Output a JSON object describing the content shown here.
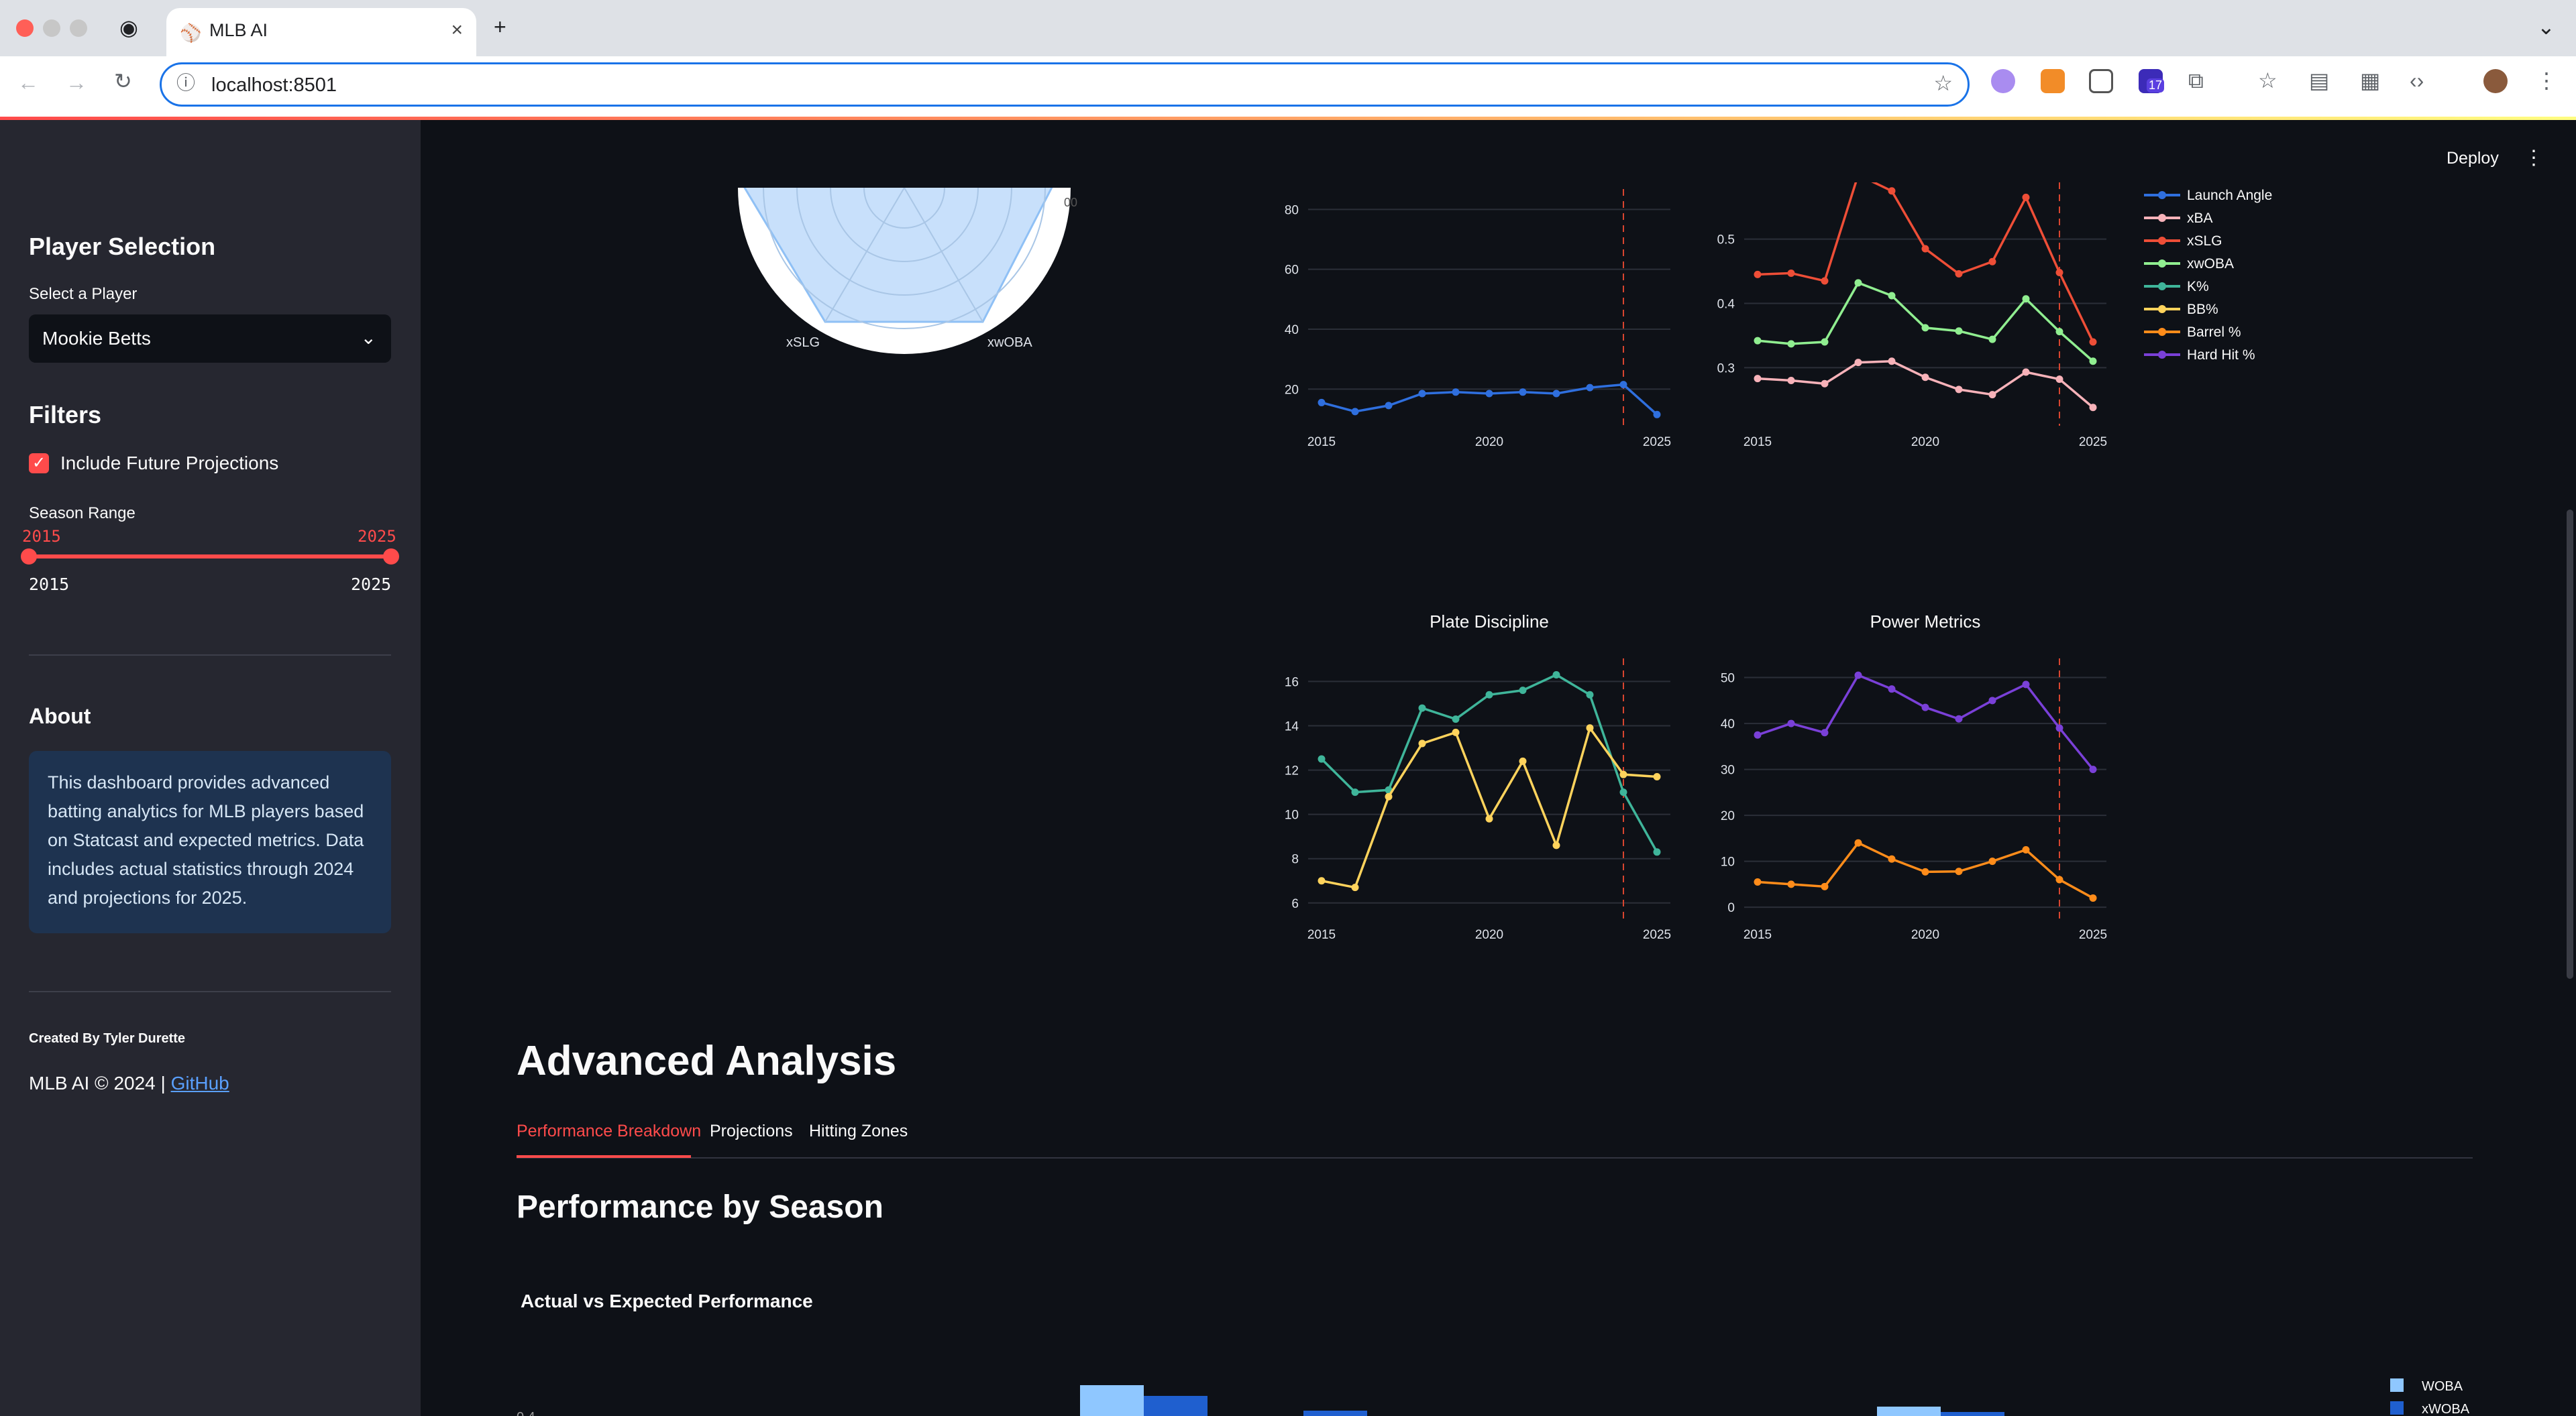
{
  "browser": {
    "tab_title": "MLB AI",
    "url": "localhost:8501",
    "extension_badge": "17"
  },
  "app": {
    "deploy_label": "Deploy",
    "menu_icon": "kebab-icon"
  },
  "sidebar": {
    "player_heading": "Player Selection",
    "select_label": "Select a Player",
    "selected_player": "Mookie Betts",
    "filters_heading": "Filters",
    "checkbox_label": "Include Future Projections",
    "checkbox_checked": true,
    "season_label": "Season Range",
    "slider_low": "2015",
    "slider_high": "2025",
    "range_min": "2015",
    "range_max": "2025",
    "about_heading": "About",
    "about_text": "This dashboard provides advanced batting analytics for MLB players based on Statcast and expected metrics. Data includes actual statistics through 2024 and projections for 2025.",
    "created_by": "Created By Tyler Durette",
    "footer_text": "MLB AI © 2024 | ",
    "footer_link": "GitHub"
  },
  "radar": {
    "labels": [
      "xSLG",
      "xwOBA"
    ],
    "partial_tick": "00"
  },
  "main": {
    "heading": "Advanced Analysis",
    "tabs": [
      "Performance Breakdown",
      "Projections",
      "Hitting Zones"
    ],
    "active_tab": "Performance Breakdown",
    "section_title": "Performance by Season",
    "chart_title": "Actual vs Expected Performance"
  },
  "chart_data": [
    {
      "type": "line",
      "title": "",
      "x": [
        2015,
        2016,
        2017,
        2018,
        2019,
        2020,
        2021,
        2022,
        2023,
        2024,
        2025
      ],
      "x_ticks": [
        2015,
        2020,
        2025
      ],
      "y_ticks": [
        20,
        40,
        60,
        80
      ],
      "projection_marker": 2024,
      "series": [
        {
          "name": "Launch Angle",
          "color": "#2f6fde",
          "values": [
            15.5,
            12.5,
            14.5,
            18.5,
            19,
            18.5,
            19,
            18.5,
            20.5,
            21.5,
            11.5
          ]
        }
      ]
    },
    {
      "type": "line",
      "title": "",
      "x": [
        2015,
        2016,
        2017,
        2018,
        2019,
        2020,
        2021,
        2022,
        2023,
        2024,
        2025
      ],
      "x_ticks": [
        2015,
        2020,
        2025
      ],
      "y_ticks": [
        0.3,
        0.4,
        0.5
      ],
      "projection_marker": 2024,
      "series": [
        {
          "name": "xBA",
          "color": "#f7b2b9",
          "values": [
            0.283,
            0.28,
            0.275,
            0.308,
            0.31,
            0.285,
            0.266,
            0.258,
            0.293,
            0.282,
            0.238
          ]
        },
        {
          "name": "xSLG",
          "color": "#ee4e37",
          "values": [
            0.445,
            0.447,
            0.435,
            0.6,
            0.575,
            0.485,
            0.446,
            0.465,
            0.565,
            0.448,
            0.34
          ]
        },
        {
          "name": "xwOBA",
          "color": "#90ee90",
          "values": [
            0.342,
            0.337,
            0.34,
            0.432,
            0.412,
            0.362,
            0.357,
            0.344,
            0.407,
            0.356,
            0.31
          ]
        }
      ]
    },
    {
      "type": "line",
      "title": "Plate Discipline",
      "x": [
        2015,
        2016,
        2017,
        2018,
        2019,
        2020,
        2021,
        2022,
        2023,
        2024,
        2025
      ],
      "x_ticks": [
        2015,
        2020,
        2025
      ],
      "y_ticks": [
        6,
        8,
        10,
        12,
        14,
        16
      ],
      "projection_marker": 2024,
      "series": [
        {
          "name": "K%",
          "color": "#3fb59a",
          "values": [
            12.5,
            11,
            11.1,
            14.8,
            14.3,
            15.4,
            15.6,
            16.3,
            15.4,
            11,
            8.3
          ]
        },
        {
          "name": "BB%",
          "color": "#ffd35c",
          "values": [
            7,
            6.7,
            10.8,
            13.2,
            13.7,
            9.8,
            12.4,
            8.6,
            13.9,
            11.8,
            11.7
          ]
        }
      ]
    },
    {
      "type": "line",
      "title": "Power Metrics",
      "x": [
        2015,
        2016,
        2017,
        2018,
        2019,
        2020,
        2021,
        2022,
        2023,
        2024,
        2025
      ],
      "x_ticks": [
        2015,
        2020,
        2025
      ],
      "y_ticks": [
        0,
        10,
        20,
        30,
        40,
        50
      ],
      "projection_marker": 2024,
      "series": [
        {
          "name": "Barrel %",
          "color": "#ff8c1a",
          "values": [
            5.5,
            5,
            4.5,
            14,
            10.5,
            7.7,
            7.8,
            10,
            12.5,
            6,
            2
          ]
        },
        {
          "name": "Hard Hit %",
          "color": "#7a40d8",
          "values": [
            37.5,
            40,
            38,
            50.5,
            47.5,
            43.5,
            41,
            45,
            48.5,
            39,
            30
          ]
        }
      ]
    },
    {
      "type": "bar",
      "title": "Actual vs Expected Performance",
      "series": [
        {
          "name": "WOBA",
          "color": "#8fc7ff"
        },
        {
          "name": "xWOBA",
          "color": "#1f5fcf"
        }
      ]
    }
  ],
  "legend": [
    {
      "name": "Launch Angle",
      "color": "#2f6fde"
    },
    {
      "name": "xBA",
      "color": "#f7b2b9"
    },
    {
      "name": "xSLG",
      "color": "#ee4e37"
    },
    {
      "name": "xwOBA",
      "color": "#90ee90"
    },
    {
      "name": "K%",
      "color": "#3fb59a"
    },
    {
      "name": "BB%",
      "color": "#ffd35c"
    },
    {
      "name": "Barrel %",
      "color": "#ff8c1a"
    },
    {
      "name": "Hard Hit %",
      "color": "#7a40d8"
    }
  ]
}
